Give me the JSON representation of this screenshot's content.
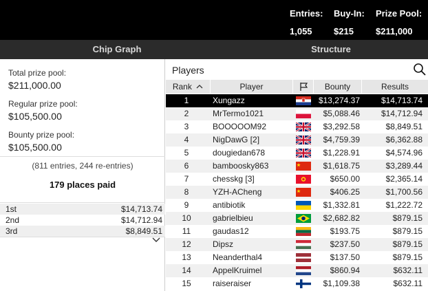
{
  "header": {
    "entries_label": "Entries:",
    "entries_value": "1,055",
    "buyin_label": "Buy-In:",
    "buyin_value": "$215",
    "prize_label": "Prize Pool:",
    "prize_value": "$211,000"
  },
  "tabs": [
    "Chip Graph",
    "Structure"
  ],
  "summary": {
    "total_label": "Total prize pool:",
    "total_value": "$211,000.00",
    "regular_label": "Regular prize pool:",
    "regular_value": "$105,500.00",
    "bounty_label": "Bounty prize pool:",
    "bounty_value": "$105,500.00",
    "entries_text": "(811 entries, 244 re-entries)",
    "places_paid": "179 places paid"
  },
  "payouts": [
    {
      "place": "1st",
      "amount": "$14,713.74"
    },
    {
      "place": "2nd",
      "amount": "$14,712.94"
    },
    {
      "place": "3rd",
      "amount": "$8,849.51"
    }
  ],
  "players": {
    "title": "Players",
    "columns": {
      "rank": "Rank",
      "player": "Player",
      "bounty": "Bounty",
      "results": "Results"
    },
    "rows": [
      {
        "rank": "1",
        "name": "Xungazz",
        "flag": "hr",
        "bounty": "$13,274.37",
        "result": "$14,713.74"
      },
      {
        "rank": "2",
        "name": "MrTermo1021",
        "flag": "pl",
        "bounty": "$5,088.46",
        "result": "$14,712.94"
      },
      {
        "rank": "3",
        "name": "BOOOOOM92",
        "flag": "gb",
        "bounty": "$3,292.58",
        "result": "$8,849.51"
      },
      {
        "rank": "4",
        "name": "NigDawG [2]",
        "flag": "gb",
        "bounty": "$4,759.39",
        "result": "$6,362.88"
      },
      {
        "rank": "5",
        "name": "dougiedan678",
        "flag": "gb",
        "bounty": "$1,228.91",
        "result": "$4,574.96"
      },
      {
        "rank": "6",
        "name": "bamboosky863",
        "flag": "cn",
        "bounty": "$1,618.75",
        "result": "$3,289.44"
      },
      {
        "rank": "7",
        "name": "chesskg [3]",
        "flag": "kg",
        "bounty": "$650.00",
        "result": "$2,365.14"
      },
      {
        "rank": "8",
        "name": "YZH-ACheng",
        "flag": "cn",
        "bounty": "$406.25",
        "result": "$1,700.56"
      },
      {
        "rank": "9",
        "name": "antibiotik",
        "flag": "ua",
        "bounty": "$1,332.81",
        "result": "$1,222.72"
      },
      {
        "rank": "10",
        "name": "gabrielbieu",
        "flag": "br",
        "bounty": "$2,682.82",
        "result": "$879.15"
      },
      {
        "rank": "11",
        "name": "gaudas12",
        "flag": "lt",
        "bounty": "$193.75",
        "result": "$879.15"
      },
      {
        "rank": "12",
        "name": "Dipsz",
        "flag": "hu",
        "bounty": "$237.50",
        "result": "$879.15"
      },
      {
        "rank": "13",
        "name": "Neanderthal4",
        "flag": "lv",
        "bounty": "$137.50",
        "result": "$879.15"
      },
      {
        "rank": "14",
        "name": "AppelKruimel",
        "flag": "nl",
        "bounty": "$860.94",
        "result": "$632.11"
      },
      {
        "rank": "15",
        "name": "raiseraiser",
        "flag": "fi",
        "bounty": "$1,109.38",
        "result": "$632.11"
      }
    ]
  }
}
